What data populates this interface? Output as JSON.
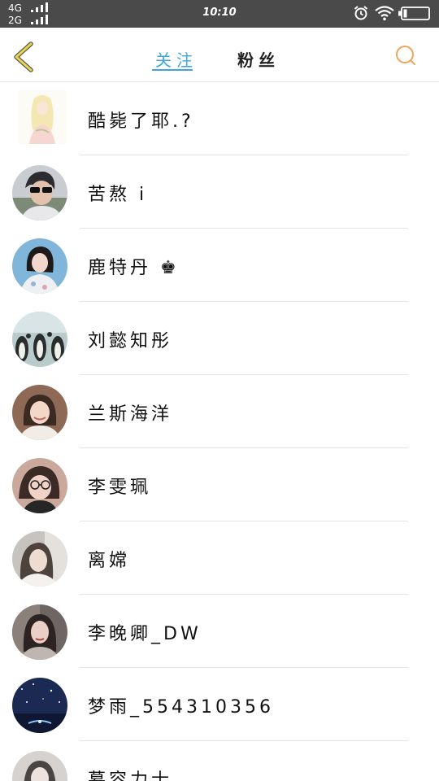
{
  "status_bar": {
    "network_1": "4G",
    "network_2": "2G",
    "time": "10:10",
    "icons": [
      "alarm-icon",
      "wifi-icon",
      "battery-icon"
    ]
  },
  "nav": {
    "back_icon": "chevron-left-icon",
    "tabs": [
      {
        "label": "关注",
        "active": true
      },
      {
        "label": "粉丝",
        "active": false
      }
    ],
    "search_icon": "search-icon",
    "accent_color": "#3da7d8",
    "back_color": "#e8d44d",
    "search_color": "#f0a45c"
  },
  "users": [
    {
      "name": "酷毙了耶.?"
    },
    {
      "name": "苦熬 i"
    },
    {
      "name": "鹿特丹 ♚"
    },
    {
      "name": "刘懿知彤"
    },
    {
      "name": "兰斯海洋"
    },
    {
      "name": "李雯珮"
    },
    {
      "name": "离嫦"
    },
    {
      "name": "李晚卿_DW"
    },
    {
      "name": "梦雨_554310356"
    },
    {
      "name": "慕容力士"
    }
  ]
}
